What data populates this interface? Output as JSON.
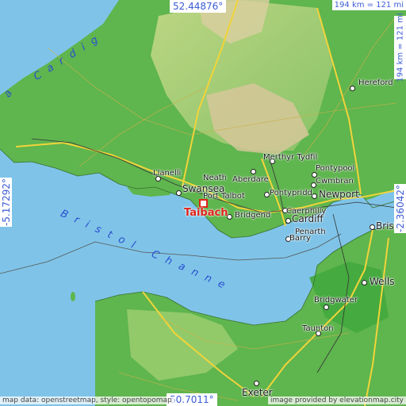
{
  "map": {
    "coords": {
      "top": "52.44876°",
      "bottom": "50.7011°",
      "left": "-5.17292°",
      "right": "-2.36042°"
    },
    "scale": {
      "horizontal": "194 km = 121 mi",
      "vertical": "194 km = 121 mi"
    },
    "seas": {
      "cardigan": "Cardig",
      "cardigan_tail": "a",
      "bristol": "Bristol Channe"
    },
    "highlight": "Taibach",
    "places": {
      "hereford": "Hereford",
      "merthyr": "Merthyr Tydfil",
      "pontypool": "Pontypool",
      "llanelli": "Llanelli",
      "neath": "Neath",
      "aberdare": "Aberdare",
      "cwmbran": "Cwmbran",
      "swansea": "Swansea",
      "newport": "Newport",
      "port_talbot": "Port Talbot",
      "pontypridd": "Pontypridd",
      "caerphilly": "Caerphilly",
      "bridgend": "Bridgend",
      "cardiff": "Cardiff",
      "bristol": "Bristol",
      "penarth": "Penarth",
      "barry": "Barry",
      "wells": "Wells",
      "bridgwater": "Bridgwater",
      "taunton": "Taunton",
      "exeter": "Exeter"
    },
    "attribution_left": "map data: openstreetmap, style: opentopomap",
    "attribution_right": "image provided by elevationmap.city"
  }
}
